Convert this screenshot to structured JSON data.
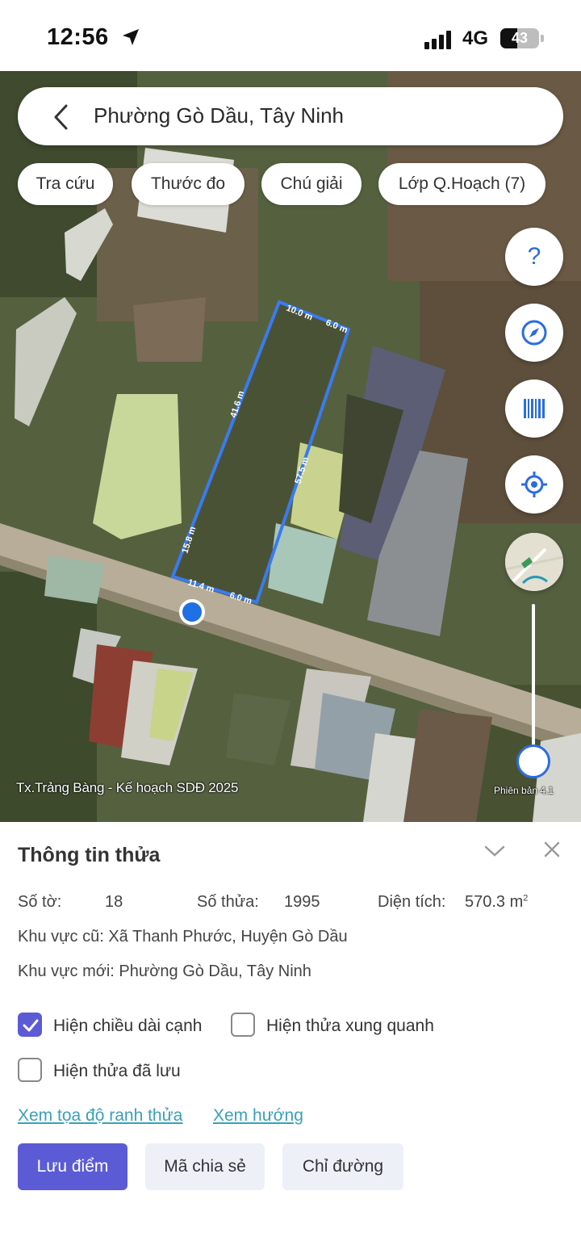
{
  "status_bar": {
    "time": "12:56",
    "network": "4G",
    "battery": "43",
    "battery_level": 0.43
  },
  "search": {
    "location": "Phường Gò Dầu, Tây Ninh"
  },
  "chips": [
    {
      "label": "Tra cứu"
    },
    {
      "label": "Thước đo"
    },
    {
      "label": "Chú giải"
    },
    {
      "label": "Lớp Q.Hoạch (7)"
    }
  ],
  "map_controls": {
    "help": "?",
    "icons": [
      "help-icon",
      "compass-icon",
      "barcode-icon",
      "locate-icon",
      "minimap-icon"
    ],
    "accent": "#2b6de0"
  },
  "parcel": {
    "edges": {
      "top_a": "10.0 m",
      "top_b": "6.0 m",
      "left": "41.6 m",
      "right": "57.5 m",
      "left_lower": "15.8 m",
      "bottom_a": "11.4 m",
      "bottom_b": "6.0 m"
    },
    "outline_color": "#3b7bf0"
  },
  "map_caption": "Tx.Trảng Bàng - Kế hoạch SDĐ 2025",
  "map_version": "Phiên bản 4.1",
  "info": {
    "title": "Thông tin thửa",
    "so_to_label": "Số tờ:",
    "so_to_value": "18",
    "so_thua_label": "Số thửa:",
    "so_thua_value": "1995",
    "dien_tich_label": "Diện tích:",
    "dien_tich_value": "570.3 m",
    "dien_tich_unit_sup": "2",
    "khu_vuc_cu": "Khu vực cũ: Xã Thanh Phước, Huyện Gò Dầu",
    "khu_vuc_moi": "Khu vực mới: Phường Gò Dầu, Tây Ninh"
  },
  "options": [
    {
      "label": "Hiện chiều dài cạnh",
      "checked": true
    },
    {
      "label": "Hiện thửa xung quanh",
      "checked": false
    },
    {
      "label": "Hiện thửa đã lưu",
      "checked": false
    }
  ],
  "links": {
    "coords": "Xem tọa độ ranh thửa",
    "direction": "Xem hướng"
  },
  "buttons": {
    "save": "Lưu điểm",
    "share": "Mã chia sẻ",
    "route": "Chỉ đường"
  },
  "colors": {
    "primary": "#5b5bd6",
    "link": "#3aa0b8"
  }
}
